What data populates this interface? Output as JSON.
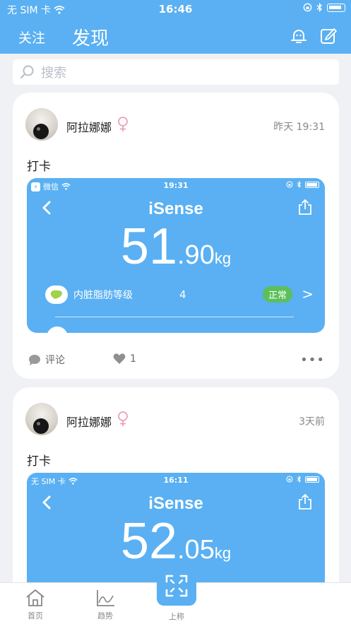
{
  "status_bar": {
    "carrier": "无 SIM 卡",
    "time": "16:46"
  },
  "nav": {
    "follow": "关注",
    "discover": "发现"
  },
  "search": {
    "placeholder": "搜索"
  },
  "posts": [
    {
      "username": "阿拉娜娜",
      "time": "昨天 19:31",
      "text": "打卡",
      "shot": {
        "status_left": "微信",
        "status_time": "19:31",
        "brand": "iSense",
        "weight_int": "51",
        "weight_dec": ".90",
        "unit": "kg",
        "metric_label": "内脏脂肪等级",
        "metric_value": "4",
        "metric_status": "正常"
      },
      "comment_label": "评论",
      "like_count": "1"
    },
    {
      "username": "阿拉娜娜",
      "time": "3天前",
      "text": "打卡",
      "shot": {
        "status_left": "无 SIM 卡",
        "status_time": "16:11",
        "brand": "iSense",
        "weight_int": "52",
        "weight_dec": ".05",
        "unit": "kg"
      }
    }
  ],
  "tabs": {
    "home": "首页",
    "trend": "趋势",
    "weigh": "上称"
  },
  "colors": {
    "primary": "#5ab0f2",
    "female": "#e9a3b6",
    "normal_badge": "#5cc05a"
  }
}
